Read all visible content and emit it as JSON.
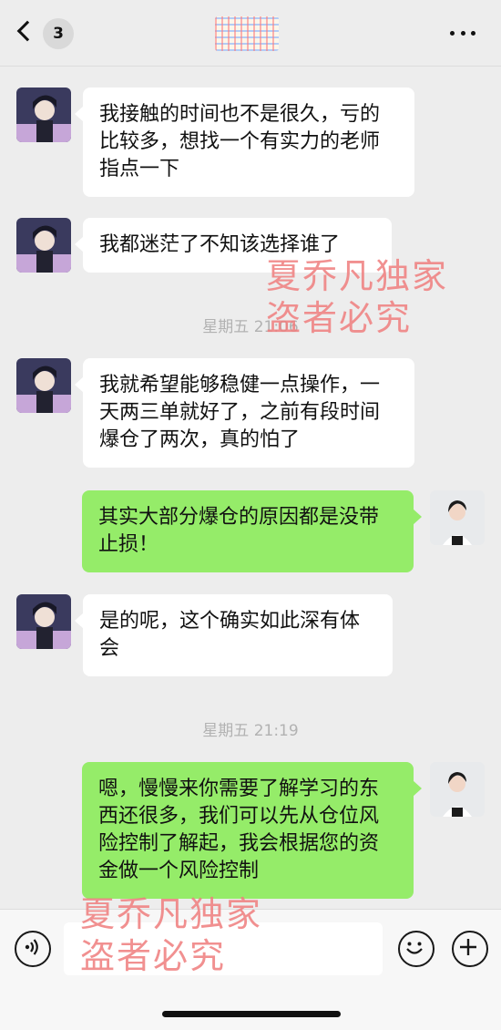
{
  "header": {
    "unread_count": "3"
  },
  "messages": [
    {
      "text": "我接触的时间也不是很久，亏的比较多，想找一个有实力的老师指点一下"
    },
    {
      "text": "我都迷茫了不知该选择谁了"
    },
    {
      "text": "我就希望能够稳健一点操作，一天两三单就好了，之前有段时间爆仓了两次，真的怕了"
    },
    {
      "text": "其实大部分爆仓的原因都是没带止损！"
    },
    {
      "text": "是的呢，这个确实如此深有体会"
    },
    {
      "text": "嗯，慢慢来你需要了解学习的东西还很多，我们可以先从仓位风险控制了解起，我会根据您的资金做一个风险控制"
    }
  ],
  "timestamps": [
    "星期五 21:06",
    "星期五 21:19"
  ],
  "watermarks": [
    {
      "line1": "夏乔凡独家",
      "line2": "盗者必究"
    },
    {
      "line1": "夏乔凡独家",
      "line2": "盗者必究"
    }
  ],
  "icons": {
    "back": "chevron-left-icon",
    "more": "more-dots-icon",
    "voice": "voice-icon",
    "emoji": "emoji-icon",
    "plus": "plus-icon"
  },
  "colors": {
    "background": "#ededed",
    "incoming_bubble": "#ffffff",
    "outgoing_bubble": "#95ec69",
    "timestamp": "#b2b2b2",
    "watermark": "#ee7d7d"
  }
}
